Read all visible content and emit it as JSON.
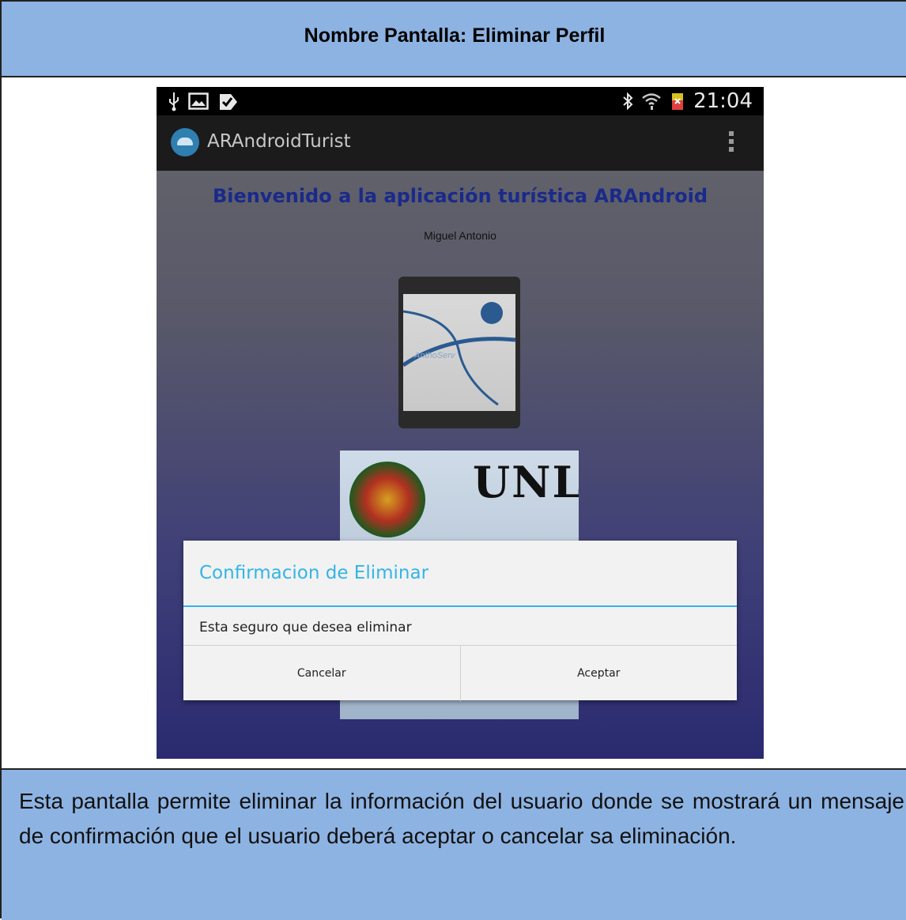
{
  "header": {
    "title": "Nombre Pantalla: Eliminar Perfil"
  },
  "phone": {
    "status_bar": {
      "left_icons": [
        "usb-icon",
        "image-icon",
        "check-icon"
      ],
      "right_icons": [
        "bluetooth-icon",
        "wifi-icon",
        "battery-icon"
      ],
      "time": "21:04"
    },
    "action_bar": {
      "app_name": "ARAndroidTurist",
      "overflow_icon": "overflow-menu-icon"
    },
    "content": {
      "welcome": "Bienvenido a la aplicación turística ARAndroid",
      "username": "Miguel Antonio",
      "profile_logo_text": "AnthoServ",
      "banner_text": "UNL"
    },
    "dialog": {
      "title": "Confirmacion de Eliminar",
      "message": "Esta seguro que desea eliminar",
      "cancel_label": "Cancelar",
      "accept_label": "Aceptar"
    }
  },
  "description": "Esta pantalla permite eliminar la información del usuario donde se mostrará un mensaje de confirmación que el usuario deberá aceptar o cancelar sa eliminación.",
  "colors": {
    "cell_blue": "#8DB3E2",
    "dialog_accent": "#33b5e5",
    "welcome_text": "#1a2a8a"
  }
}
